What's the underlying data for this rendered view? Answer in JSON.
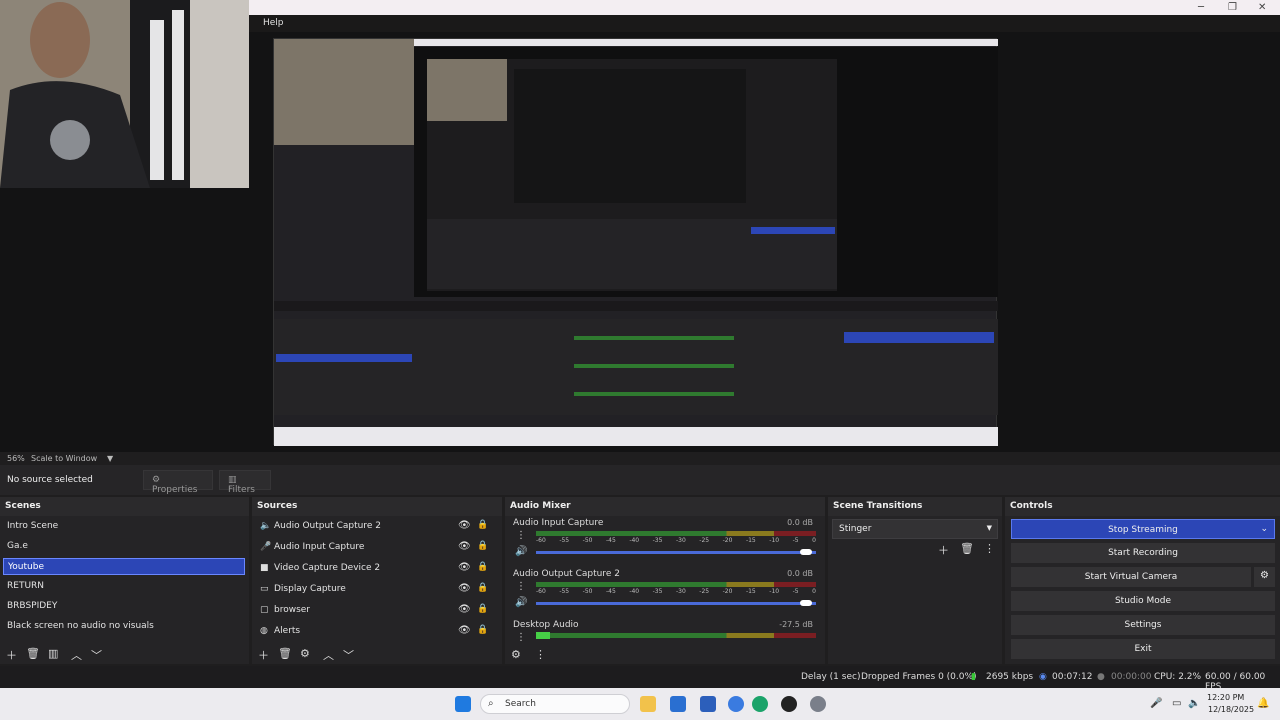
{
  "menu": {
    "help": "Help"
  },
  "preview": {
    "zoom": "56%",
    "scale_mode": "Scale to Window"
  },
  "source_bar": {
    "no_source": "No source selected",
    "properties": "Properties",
    "filters": "Filters"
  },
  "scenes": {
    "header": "Scenes",
    "items": [
      "Intro Scene",
      "Ga.e",
      "Youtube",
      "RETURN",
      "BRBSPIDEY",
      "Black screen no audio no visuals"
    ],
    "selected": "Youtube"
  },
  "sources": {
    "header": "Sources",
    "items": [
      {
        "label": "Audio Output Capture 2",
        "icon": "speaker-icon"
      },
      {
        "label": "Audio Input Capture",
        "icon": "microphone-icon"
      },
      {
        "label": "Video Capture Device 2",
        "icon": "camera-icon"
      },
      {
        "label": "Display Capture",
        "icon": "monitor-icon"
      },
      {
        "label": "browser",
        "icon": "browser-icon"
      },
      {
        "label": "Alerts",
        "icon": "globe-icon"
      }
    ]
  },
  "mixer": {
    "header": "Audio Mixer",
    "ticks": [
      "-60",
      "-55",
      "-50",
      "-45",
      "-40",
      "-35",
      "-30",
      "-25",
      "-20",
      "-15",
      "-10",
      "-5",
      "0"
    ],
    "channels": [
      {
        "name": "Audio Input Capture",
        "db": "0.0 dB"
      },
      {
        "name": "Audio Output Capture 2",
        "db": "0.0 dB"
      },
      {
        "name": "Desktop Audio",
        "db": "-27.5 dB"
      }
    ]
  },
  "transitions": {
    "header": "Scene Transitions",
    "selected": "Stinger"
  },
  "controls": {
    "header": "Controls",
    "stop_streaming": "Stop Streaming",
    "start_recording": "Start Recording",
    "start_virtual_camera": "Start Virtual Camera",
    "studio_mode": "Studio Mode",
    "settings": "Settings",
    "exit": "Exit"
  },
  "status": {
    "delay": "Delay (1 sec)",
    "dropped": "Dropped Frames 0 (0.0%)",
    "bitrate": "2695 kbps",
    "stream_time": "00:07:12",
    "rec_time": "00:00:00",
    "cpu": "CPU: 2.2%",
    "fps": "60.00 / 60.00 FPS"
  },
  "taskbar": {
    "search": "Search",
    "time": "12:20 PM",
    "date": "12/18/2025"
  },
  "colors": {
    "accent": "#2c46b6",
    "meter_green": "#2f7a2f",
    "meter_yellow": "#8a7a1e",
    "meter_red": "#7a1e22"
  }
}
